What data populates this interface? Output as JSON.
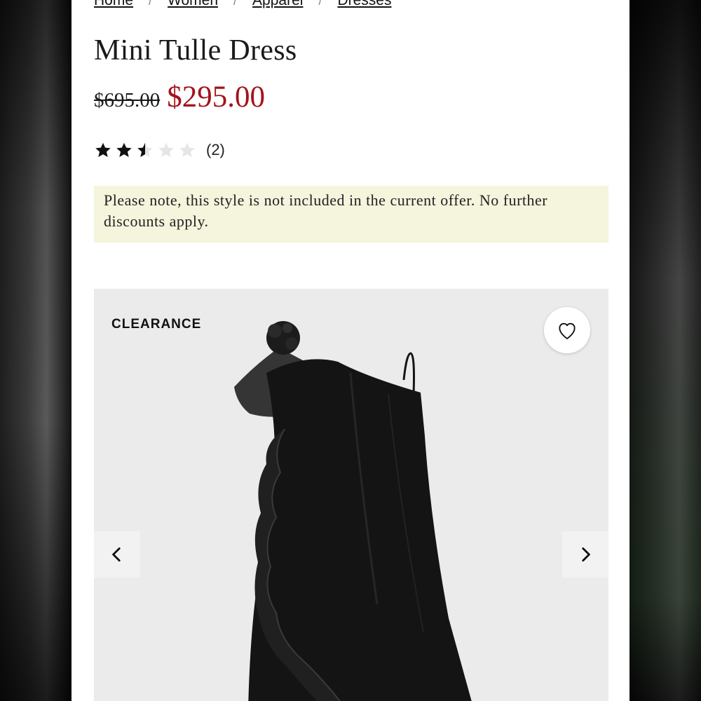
{
  "breadcrumb": {
    "items": [
      "Home",
      "Women",
      "Apparel",
      "Dresses"
    ],
    "separator": "/"
  },
  "product": {
    "title": "Mini Tulle Dress",
    "original_price": "$695.00",
    "sale_price": "$295.00",
    "sale_color": "#a4121b",
    "rating": {
      "value": 2.5,
      "max": 5,
      "count_label": "(2)"
    },
    "notice": "Please note, this style is not included in the current offer. No further discounts apply.",
    "notice_bg": "#f5f4dd"
  },
  "gallery": {
    "badge": "CLEARANCE",
    "wishlist_icon": "heart-icon",
    "prev_icon": "chevron-left-icon",
    "next_icon": "chevron-right-icon",
    "image": "black-tulle-one-shoulder-dress"
  }
}
